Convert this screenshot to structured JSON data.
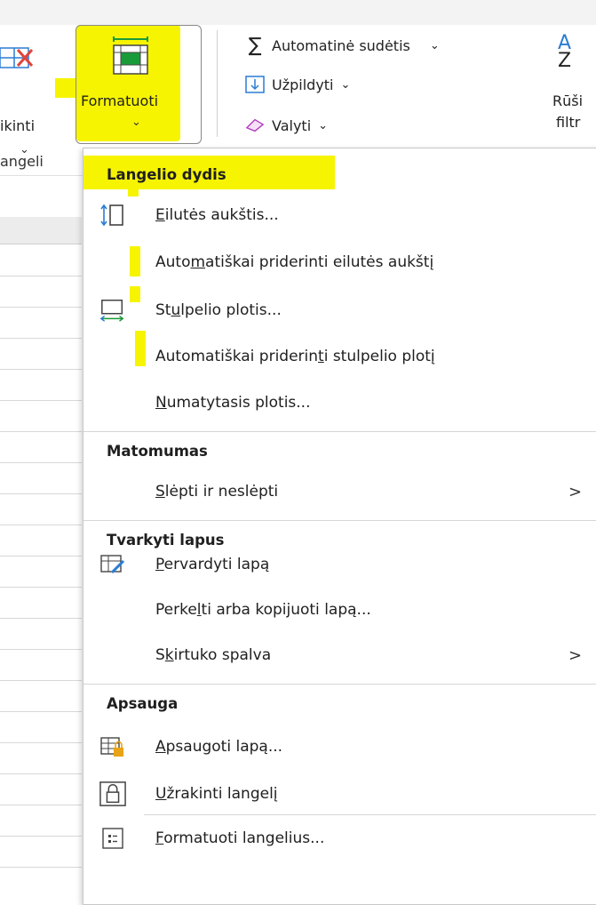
{
  "ribbon": {
    "delete_label": "ikinti",
    "format_label": "Formatuoti",
    "autosum_label": "Automatinė sudėtis",
    "fill_label": "Užpildyti",
    "clear_label": "Valyti",
    "sort_label_1": "Rūši",
    "sort_label_2": "filtr",
    "group_label": "angeli"
  },
  "menu": {
    "sections": [
      {
        "title": "Langelio dydis",
        "items": [
          {
            "icon": "row-height-icon",
            "pre": "",
            "ul": "E",
            "post": "ilutės aukštis..."
          },
          {
            "icon": "",
            "pre": "Auto",
            "ul": "m",
            "post": "atiškai priderinti eilutės aukštį"
          },
          {
            "icon": "column-width-icon",
            "pre": "St",
            "ul": "u",
            "post": "lpelio plotis..."
          },
          {
            "icon": "",
            "pre": "Automatiškai priderin",
            "ul": "t",
            "post": "i stulpelio plotį"
          },
          {
            "icon": "",
            "pre": "",
            "ul": "N",
            "post": "umatytasis plotis..."
          }
        ]
      },
      {
        "title": "Matomumas",
        "items": [
          {
            "icon": "",
            "pre": "",
            "ul": "S",
            "post": "lėpti ir neslėpti",
            "submenu": ">"
          }
        ]
      },
      {
        "title": "Tvarkyti lapus",
        "items": [
          {
            "icon": "rename-sheet-icon",
            "pre": "",
            "ul": "P",
            "post": "ervardyti lapą"
          },
          {
            "icon": "",
            "pre": "Perke",
            "ul": "l",
            "post": "ti arba kopijuoti lapą..."
          },
          {
            "icon": "",
            "pre": "S",
            "ul": "k",
            "post": "irtuko spalva",
            "submenu": ">"
          }
        ]
      },
      {
        "title": "Apsauga",
        "items": [
          {
            "icon": "protect-sheet-icon",
            "pre": "",
            "ul": "A",
            "post": "psaugoti lapą..."
          },
          {
            "icon": "lock-cell-icon",
            "pre": "",
            "ul": "U",
            "post": "žrakinti langelį"
          },
          {
            "icon": "format-cells-icon",
            "pre": "",
            "ul": "F",
            "post": "ormatuoti langelius..."
          }
        ]
      }
    ]
  },
  "colors": {
    "highlight": "#f6f400",
    "accent": "#2b7cd3",
    "cell_green": "#1a9b3a"
  }
}
